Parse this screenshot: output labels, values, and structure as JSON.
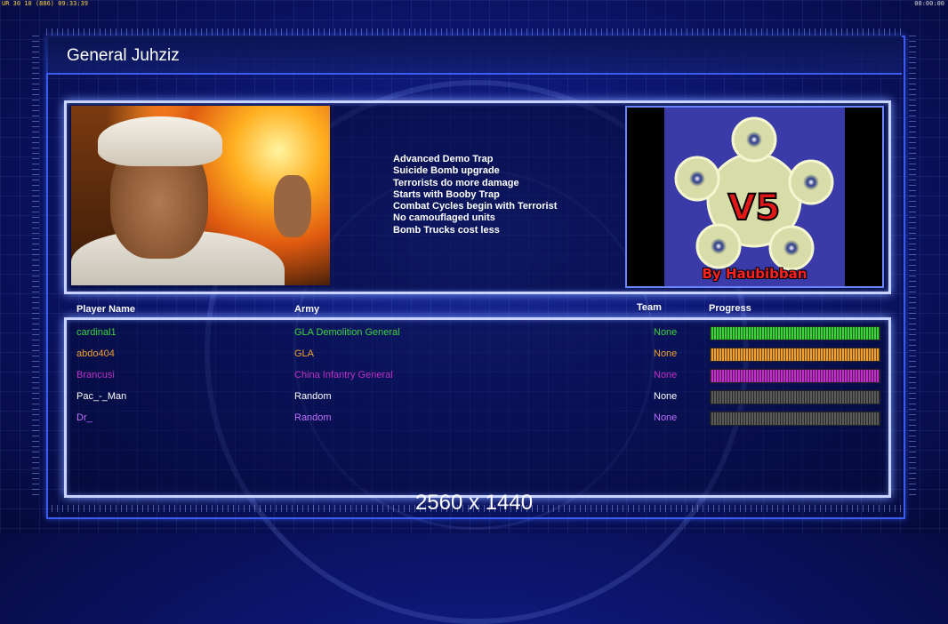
{
  "hud": {
    "left": "UR 30 10 (886) 09:33:39",
    "right": "00:00:00"
  },
  "title": "General Juhziz",
  "traits": [
    "Advanced Demo Trap",
    "Suicide Bomb upgrade",
    "Terrorists do more damage",
    "Starts with Booby Trap",
    "Combat Cycles begin with Terrorist",
    "No camouflaged units",
    "Bomb Trucks cost less"
  ],
  "logo": {
    "version": "V5",
    "byline": "By Haubibban"
  },
  "table": {
    "headers": {
      "player": "Player Name",
      "army": "Army",
      "team": "Team",
      "progress": "Progress"
    },
    "rows": [
      {
        "player": "cardinal1",
        "army": "GLA Demolition General",
        "team": "None",
        "color": "#3cd23c",
        "progress": 100
      },
      {
        "player": "abdo404",
        "army": "GLA",
        "team": "None",
        "color": "#f0a030",
        "progress": 100
      },
      {
        "player": "Brancusi",
        "army": "China Infantry General",
        "team": "None",
        "color": "#c030c8",
        "progress": 100
      },
      {
        "player": "Pac_-_Man",
        "army": "Random",
        "team": "None",
        "color": "#ffffff",
        "progress": 100
      },
      {
        "player": "Dr_",
        "army": "Random",
        "team": "None",
        "color": "#c070ff",
        "progress": 100
      }
    ]
  },
  "resolution": "2560 x 1440"
}
